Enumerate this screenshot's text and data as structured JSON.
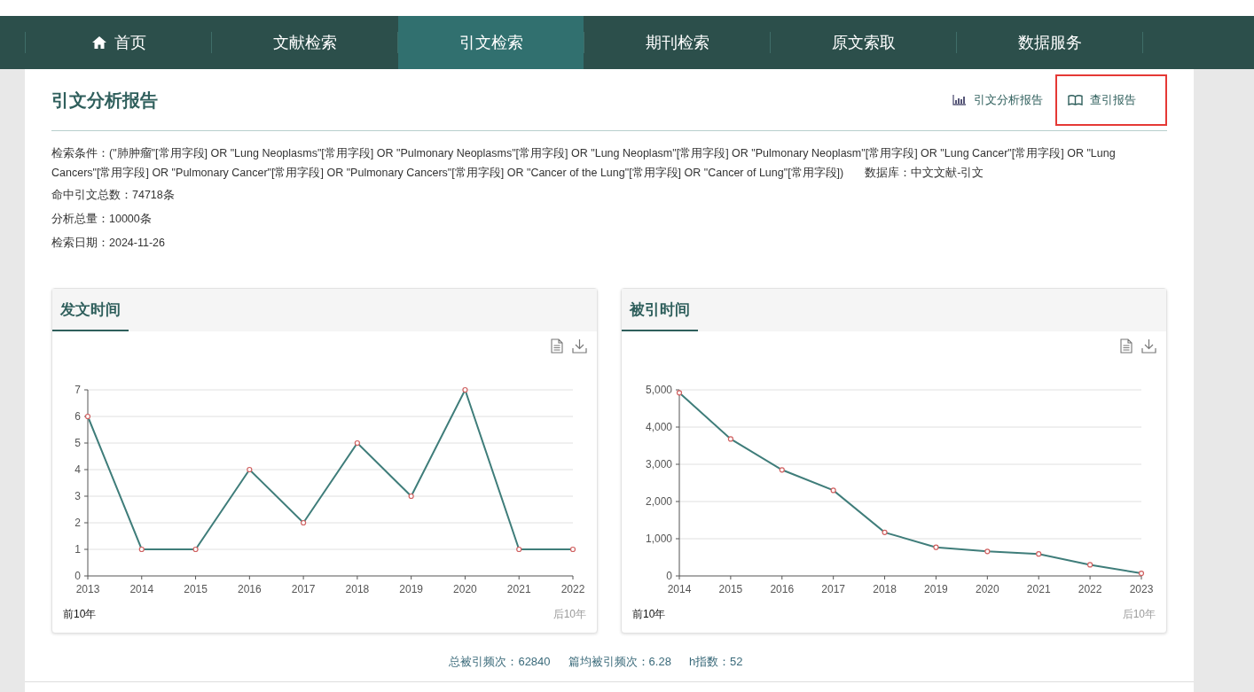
{
  "nav": [
    {
      "label": "首页",
      "selected": false
    },
    {
      "label": "文献检索",
      "selected": false
    },
    {
      "label": "引文检索",
      "selected": true
    },
    {
      "label": "期刊检索",
      "selected": false
    },
    {
      "label": "原文索取",
      "selected": false
    },
    {
      "label": "数据服务",
      "selected": false
    }
  ],
  "report": {
    "title": "引文分析报告",
    "links": [
      {
        "label": "引文分析报告",
        "highlighted": false
      },
      {
        "label": "查引报告",
        "highlighted": true
      }
    ]
  },
  "query": {
    "label": "检索条件：",
    "text": "(\"肺肿瘤\"[常用字段] OR \"Lung Neoplasms\"[常用字段] OR \"Pulmonary Neoplasms\"[常用字段] OR \"Lung Neoplasm\"[常用字段] OR \"Pulmonary Neoplasm\"[常用字段] OR \"Lung Cancer\"[常用字段] OR \"Lung Cancers\"[常用字段] OR \"Pulmonary Cancer\"[常用字段] OR \"Pulmonary Cancers\"[常用字段] OR \"Cancer of the Lung\"[常用字段] OR \"Cancer of Lung\"[常用字段])",
    "database": "数据库：中文文献-引文"
  },
  "facts": [
    "命中引文总数：74718条",
    "分析总量：10000条",
    "检索日期：2024-11-26"
  ],
  "panels": [
    {
      "title": "发文时间",
      "prev": "前10年",
      "next": "后10年",
      "chart_data": {
        "type": "line",
        "categories": [
          "2013",
          "2014",
          "2015",
          "2016",
          "2017",
          "2018",
          "2019",
          "2020",
          "2021",
          "2022"
        ],
        "series": [
          {
            "color": "#3f7d7a",
            "marker": true,
            "values": [
              6,
              1,
              1,
              4,
              2,
              5,
              3,
              7,
              1,
              1
            ]
          }
        ],
        "grid": true,
        "ylim": [
          0,
          7
        ],
        "yticks": [
          0,
          1,
          2,
          3,
          4,
          5,
          6,
          7
        ]
      }
    },
    {
      "title": "被引时间",
      "prev": "前10年",
      "next": "后10年",
      "chart_data": {
        "type": "line",
        "categories": [
          "2014",
          "2015",
          "2016",
          "2017",
          "2018",
          "2019",
          "2020",
          "2021",
          "2022",
          "2023"
        ],
        "series": [
          {
            "color": "#3f7d7a",
            "marker": true,
            "values": [
              4920,
              3680,
              2850,
              2300,
              1170,
              770,
              660,
              590,
              300,
              70
            ]
          }
        ],
        "grid": true,
        "ylim": [
          0,
          5000
        ],
        "yticks": [
          {
            "value": 0,
            "label": "0"
          },
          {
            "value": 1000,
            "label": "1,000"
          },
          {
            "value": 2000,
            "label": "2,000"
          },
          {
            "value": 3000,
            "label": "3,000"
          },
          {
            "value": 4000,
            "label": "4,000"
          },
          {
            "value": 5000,
            "label": "5,000"
          }
        ]
      }
    }
  ],
  "summary": [
    "总被引频次：62840",
    "篇均被引频次：6.28",
    "h指数：52"
  ]
}
